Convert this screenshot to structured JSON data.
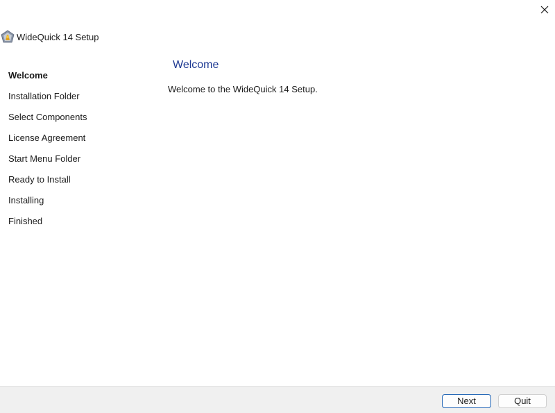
{
  "window": {
    "title": "WideQuick 14 Setup",
    "close_icon": "close-icon"
  },
  "sidebar": {
    "steps": [
      {
        "label": "Welcome",
        "active": true
      },
      {
        "label": "Installation Folder",
        "active": false
      },
      {
        "label": "Select Components",
        "active": false
      },
      {
        "label": "License Agreement",
        "active": false
      },
      {
        "label": "Start Menu Folder",
        "active": false
      },
      {
        "label": "Ready to Install",
        "active": false
      },
      {
        "label": "Installing",
        "active": false
      },
      {
        "label": "Finished",
        "active": false
      }
    ]
  },
  "main": {
    "heading": "Welcome",
    "text": "Welcome to the WideQuick 14 Setup."
  },
  "footer": {
    "next_label": "Next",
    "quit_label": "Quit"
  },
  "colors": {
    "heading": "#1f3a93",
    "footer_bg": "#f0f0f0",
    "next_border": "#1e63b5"
  }
}
